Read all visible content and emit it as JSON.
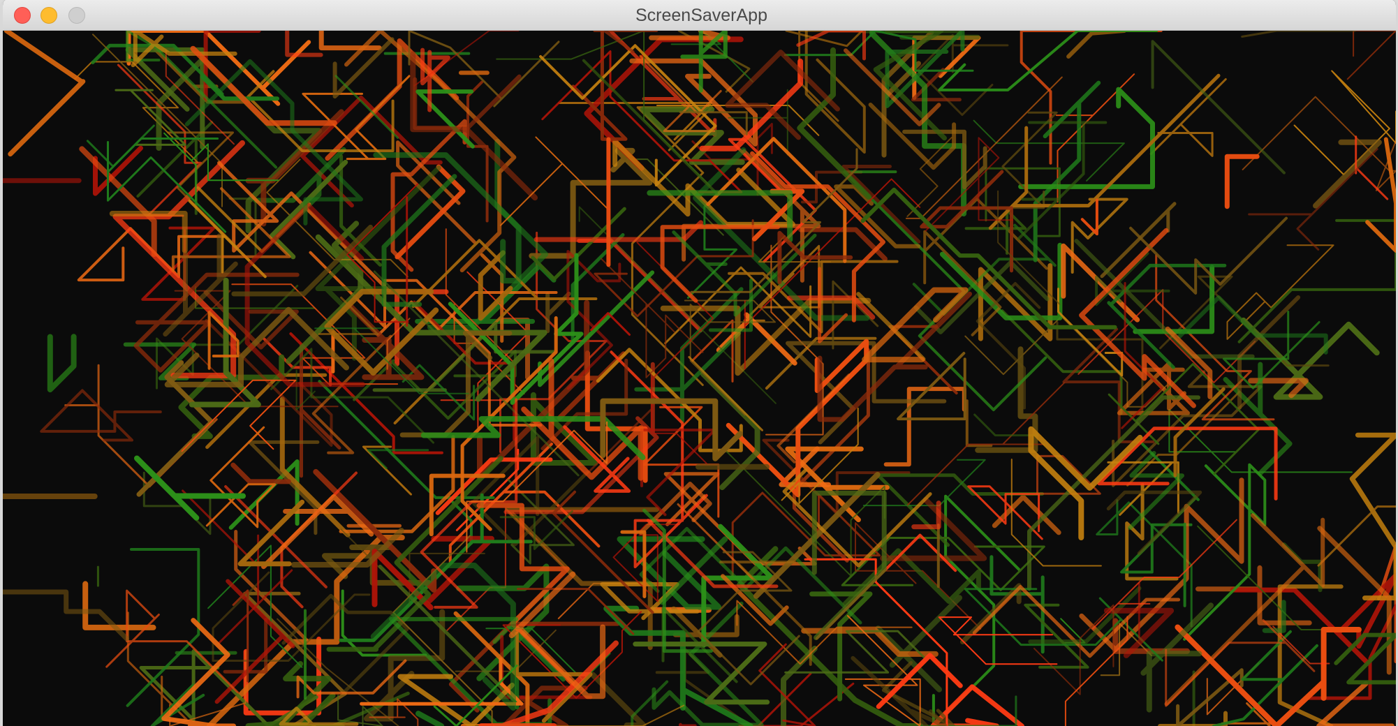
{
  "window": {
    "title": "ScreenSaverApp"
  },
  "titlebar_buttons": {
    "close": "close-icon",
    "minimize": "minimize-icon",
    "zoom": "zoom-icon"
  },
  "screensaver": {
    "background_color": "#0b0b0b",
    "palette": [
      "#ff3b14",
      "#e84d10",
      "#d9670f",
      "#c7820f",
      "#a4670d",
      "#7e5a12",
      "#5f4a0f",
      "#1f7a1b",
      "#2c8f19",
      "#4c6b16",
      "#b01408",
      "#8c2b0b",
      "#f06b14",
      "#35600f"
    ]
  }
}
